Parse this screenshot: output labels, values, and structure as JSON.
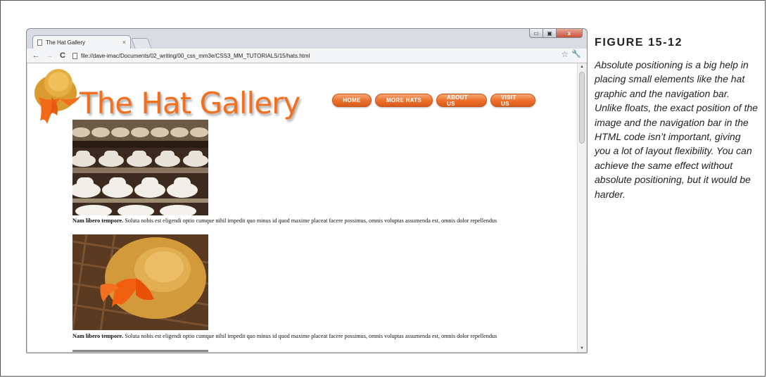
{
  "browser": {
    "tab_title": "The Hat Gallery",
    "tab_close": "×",
    "url": "file://dave-imac/Documents/02_writing/00_css_mm3e/CSS3_MM_TUTORIALS/15/hats.html",
    "back_icon": "←",
    "forward_icon": "→",
    "reload_icon": "C",
    "window_controls": {
      "minimize": "▭",
      "maximize": "▣",
      "close": "x"
    }
  },
  "site": {
    "title": "The Hat Gallery",
    "nav": [
      "HOME",
      "MORE HATS",
      "ABOUT US",
      "VISIT US"
    ],
    "captions": [
      {
        "bold": "Nam libero tempore.",
        "text": " Soluta nobis est eligendi optio cumque nihil impedit quo minus id quod maxime placeat facere possimus, omnis voluptas assumenda est, omnis dolor repellendus"
      },
      {
        "bold": "Nam libero tempore.",
        "text": " Soluta nobis est eligendi optio cumque nihil impedit quo minus id quod maxime placeat facere possimus, omnis voluptas assumenda est, omnis dolor repellendus"
      }
    ],
    "colors": {
      "accent": "#f07020",
      "nav_button": "#ec6f2a"
    }
  },
  "figure": {
    "label": "FIGURE 15-12",
    "caption": "Absolute positioning is a big help in placing small elements like the hat graphic and the navigation bar. Unlike floats, the exact position of the image and the navigation bar in the HTML code isn’t important, giving you a lot of layout flexibility. You can achieve the same effect without absolute positioning, but it would be harder."
  }
}
